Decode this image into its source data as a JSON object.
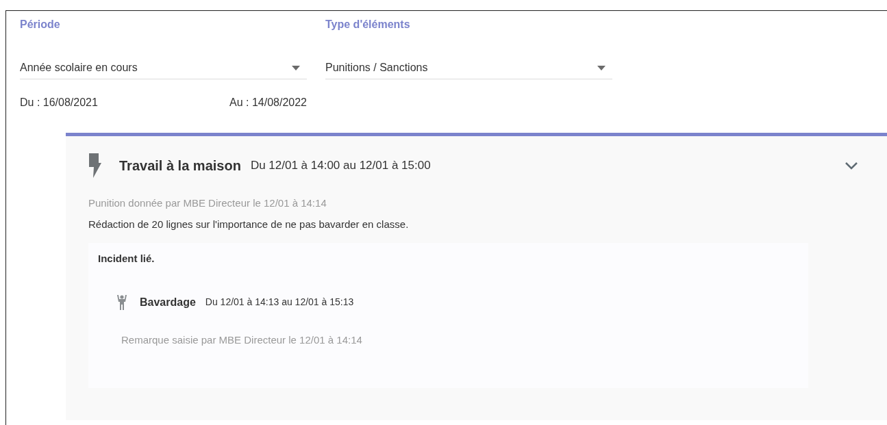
{
  "filters": [
    {
      "label": "Période",
      "value": "Année scolaire en cours"
    },
    {
      "label": "Type d'éléments",
      "value": "Punitions / Sanctions"
    }
  ],
  "dates": {
    "from": "Du : 16/08/2021",
    "to": "Au : 14/08/2022"
  },
  "punishment": {
    "title": "Travail à la maison",
    "period": "Du 12/01 à 14:00 au 12/01 à 15:00",
    "given_by": "Punition donnée par MBE Directeur le 12/01 à 14:14",
    "description": "Rédaction de 20 lignes sur l'importance de ne pas bavarder en classe.",
    "linked": {
      "heading": "Incident lié.",
      "title": "Bavardage",
      "period": "Du 12/01 à 14:13 au 12/01 à 15:13",
      "remark": "Remarque saisie par MBE Directeur le 12/01 à 14:14"
    }
  }
}
